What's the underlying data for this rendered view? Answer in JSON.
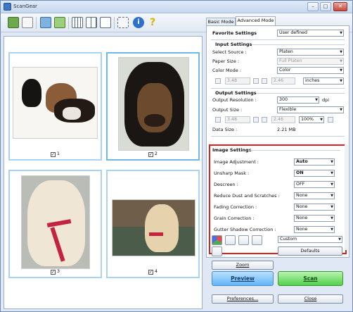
{
  "window": {
    "title": "ScanGear",
    "minimize": "–",
    "maximize": "□",
    "close": "✕"
  },
  "toolbar": {
    "icons": [
      "scan-icon",
      "blank-page-icon",
      "scan-export-icon",
      "scan-fit-icon",
      "grid-small-icon",
      "grid-medium-icon",
      "grid-large-icon",
      "fit-icon",
      "info-icon",
      "help-icon"
    ]
  },
  "thumbnails": [
    {
      "label": "1",
      "checked": true,
      "selected": false
    },
    {
      "label": "2",
      "checked": true,
      "selected": true
    },
    {
      "label": "3",
      "checked": true,
      "selected": false
    },
    {
      "label": "4",
      "checked": true,
      "selected": false
    }
  ],
  "tabs": {
    "basic": "Basic Mode",
    "advanced": "Advanced Mode"
  },
  "favorite": {
    "label": "Favorite Settings",
    "value": "User defined"
  },
  "input_settings": {
    "title": "Input Settings",
    "select_source": {
      "label": "Select Source :",
      "value": "Platen"
    },
    "paper_size": {
      "label": "Paper Size :",
      "value": "Full Platen"
    },
    "color_mode": {
      "label": "Color Mode :",
      "value": "Color"
    },
    "width": "3.48",
    "height": "2.46",
    "unit": "inches"
  },
  "output_settings": {
    "title": "Output Settings",
    "resolution": {
      "label": "Output Resolution :",
      "value": "300",
      "unit": "dpi"
    },
    "output_size": {
      "label": "Output Size :",
      "value": "Flexible"
    },
    "width": "3.48",
    "height": "2.46",
    "scale": "100%",
    "data_size": {
      "label": "Data Size :",
      "value": "2.21 MB"
    }
  },
  "image_settings": {
    "title": "Image Settings",
    "rows": [
      {
        "label": "Image Adjustment :",
        "value": "Auto",
        "bold": true
      },
      {
        "label": "Unsharp Mask :",
        "value": "ON",
        "bold": true
      },
      {
        "label": "Descreen :",
        "value": "OFF",
        "bold": false
      },
      {
        "label": "Reduce Dust and Scratches :",
        "value": "None",
        "bold": false
      },
      {
        "label": "Fading Correction :",
        "value": "None",
        "bold": false
      },
      {
        "label": "Grain Correction :",
        "value": "None",
        "bold": false
      },
      {
        "label": "Gutter Shadow Correction :",
        "value": "None",
        "bold": false
      }
    ]
  },
  "adjust": {
    "preset": "Custom",
    "defaults": "Defaults"
  },
  "buttons": {
    "zoom": "Zoom",
    "preview": "Preview",
    "scan": "Scan",
    "preferences": "Preferences...",
    "close": "Close"
  },
  "colors": {
    "highlight_box": "#e01f1f",
    "preview_button": "#62b6f5",
    "scan_button": "#52d04a"
  }
}
